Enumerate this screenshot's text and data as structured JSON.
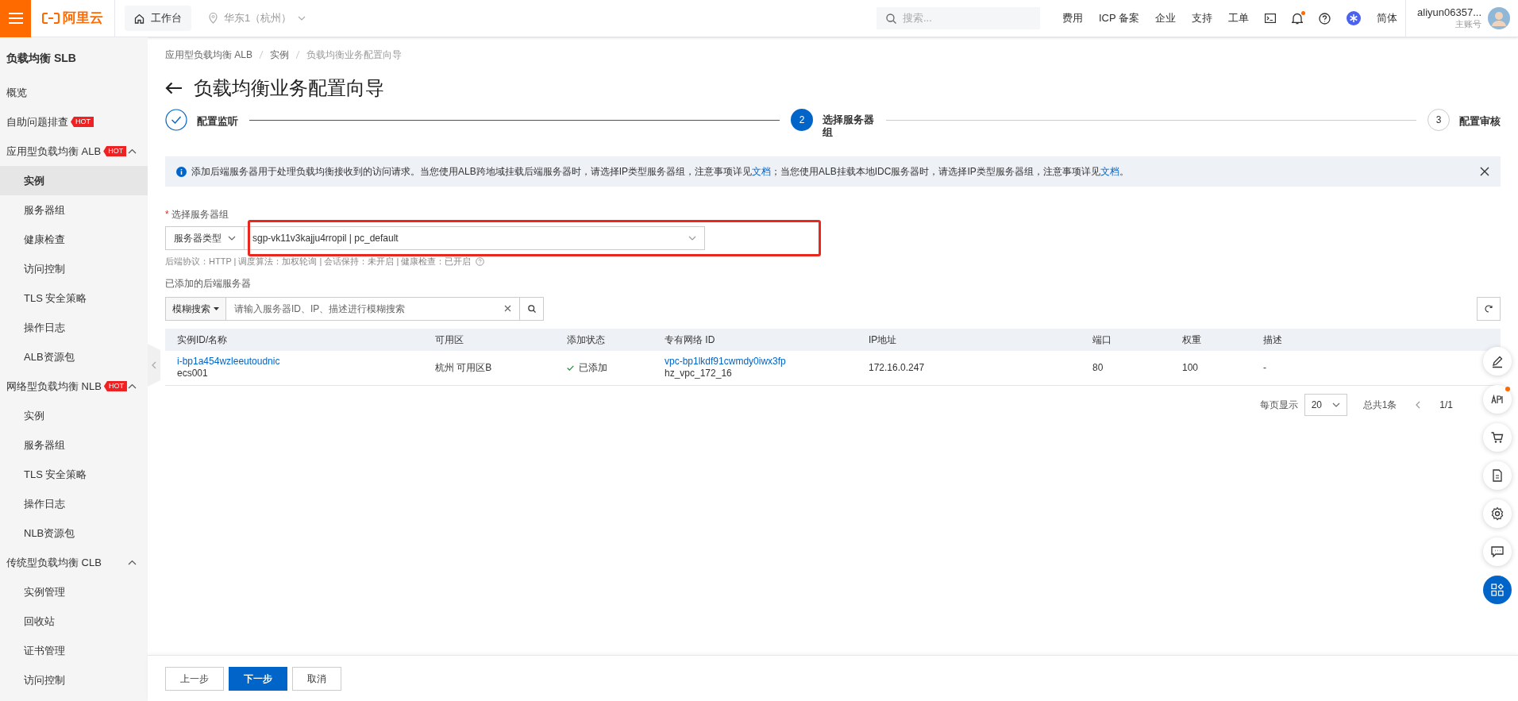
{
  "topbar": {
    "logo": "阿里云",
    "workbench": "工作台",
    "region": "华东1（杭州）",
    "search_placeholder": "搜索...",
    "links": [
      "费用",
      "ICP 备案",
      "企业",
      "支持",
      "工单"
    ],
    "notification_dot": true,
    "language": "简体",
    "account": "aliyun06357...",
    "account_role": "主账号"
  },
  "sidebar": {
    "title": "负载均衡 SLB",
    "items": [
      {
        "label": "概览",
        "selected": false
      },
      {
        "label": "自助问题排查",
        "badge": "HOT",
        "selected": false
      },
      {
        "label": "应用型负载均衡 ALB",
        "badge": "HOT",
        "expanded": true,
        "children": [
          {
            "label": "实例",
            "selected": true
          },
          {
            "label": "服务器组",
            "selected": false
          },
          {
            "label": "健康检查",
            "selected": false
          },
          {
            "label": "访问控制",
            "selected": false
          },
          {
            "label": "TLS 安全策略",
            "selected": false
          },
          {
            "label": "操作日志",
            "selected": false
          },
          {
            "label": "ALB资源包",
            "selected": false
          }
        ]
      },
      {
        "label": "网络型负载均衡 NLB",
        "badge": "HOT",
        "expanded": true,
        "children": [
          {
            "label": "实例",
            "selected": false
          },
          {
            "label": "服务器组",
            "selected": false
          },
          {
            "label": "TLS 安全策略",
            "selected": false
          },
          {
            "label": "操作日志",
            "selected": false
          },
          {
            "label": "NLB资源包",
            "selected": false
          }
        ]
      },
      {
        "label": "传统型负载均衡 CLB",
        "expanded": true,
        "children": [
          {
            "label": "实例管理",
            "selected": false
          },
          {
            "label": "回收站",
            "selected": false
          },
          {
            "label": "证书管理",
            "selected": false
          },
          {
            "label": "访问控制",
            "selected": false
          }
        ]
      }
    ]
  },
  "breadcrumb": [
    "应用型负载均衡 ALB",
    "实例",
    "负载均衡业务配置向导"
  ],
  "title": "负载均衡业务配置向导",
  "steps": [
    {
      "label": "配置监听",
      "done": true,
      "current": false
    },
    {
      "number": "2",
      "label": "选择服务器组",
      "done": false,
      "current": true
    },
    {
      "number": "3",
      "label": "配置审核",
      "done": false,
      "current": false
    }
  ],
  "notice": {
    "text": "添加后端服务器用于处理负载均衡接收到的访问请求。当您使用ALB跨地域挂载后端服务器时，请选择IP类型服务器组，注意事项详见",
    "link1": "文档",
    "middle": "；当您使用ALB挂载本地IDC服务器时，请选择IP类型服务器组，注意事项详见",
    "link2": "文档",
    "end": "。"
  },
  "form": {
    "required_mark": "*",
    "label": "选择服务器组",
    "type_select": "服务器类型",
    "group_value": "sgp-vk11v3kajju4rropil | pc_default",
    "highlighted": true,
    "hint": "后端协议：HTTP | 调度算法：加权轮询 | 会话保持：未开启 | 健康检查：已开启"
  },
  "servers": {
    "title": "已添加的后端服务器",
    "filter": "模糊搜索",
    "search_placeholder": "请输入服务器ID、IP、描述进行模糊搜索",
    "columns": [
      "实例ID/名称",
      "可用区",
      "添加状态",
      "专有网络 ID",
      "IP地址",
      "端口",
      "权重",
      "描述"
    ],
    "rows": [
      {
        "id": "i-bp1a454wzleeutoudnic",
        "name": "ecs001",
        "zone": "杭州 可用区B",
        "status": "已添加",
        "added": true,
        "vpc": "vpc-bp1lkdf91cwmdy0iwx3fp",
        "vpc_name": "hz_vpc_172_16",
        "ip": "172.16.0.247",
        "port": "80",
        "weight": "100",
        "description": "-"
      }
    ]
  },
  "pagination": {
    "per_page_label": "每页显示",
    "per_page": "20",
    "total": "总共1条",
    "page": "1/1"
  },
  "footer_buttons": [
    {
      "label": "上一步",
      "primary": false
    },
    {
      "label": "下一步",
      "primary": true
    },
    {
      "label": "取消",
      "primary": false
    }
  ]
}
